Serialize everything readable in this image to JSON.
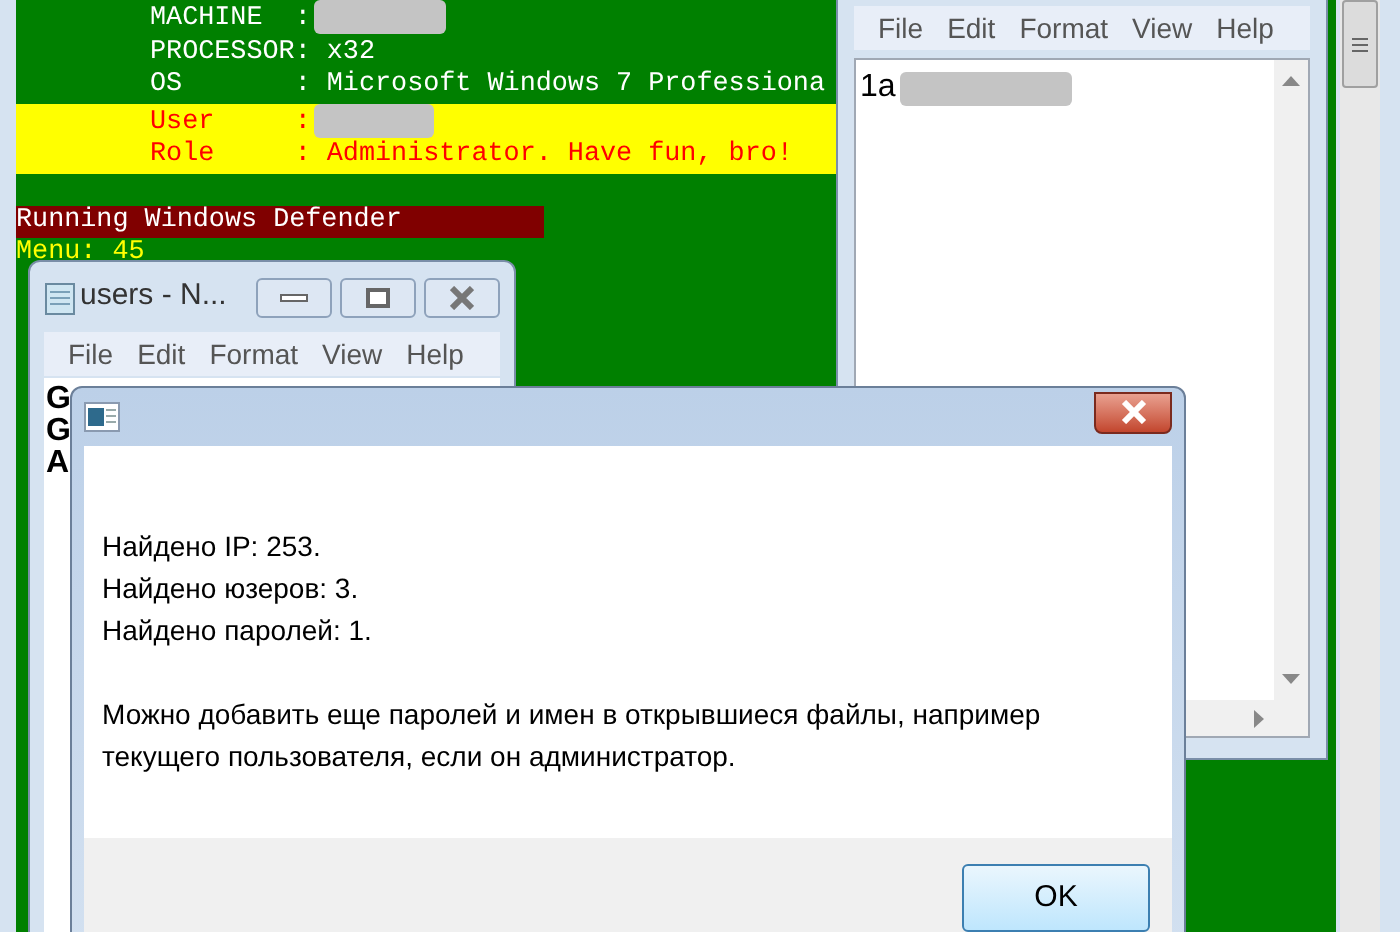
{
  "console": {
    "lines": [
      {
        "text": "MACHINE  :",
        "redacted": true,
        "highlight": false
      },
      {
        "text": "PROCESSOR: x32",
        "redacted": false,
        "highlight": false
      },
      {
        "text": "OS       : Microsoft Windows 7 Professiona",
        "redacted": false,
        "highlight": false
      },
      {
        "text": "User     :",
        "redacted": true,
        "highlight": true
      },
      {
        "text": "Role     : Administrator. Have fun, bro!",
        "redacted": false,
        "highlight": true
      }
    ],
    "status": "Running Windows Defender",
    "menu_line": "Menu: 45"
  },
  "notepad_right": {
    "menu": [
      "File",
      "Edit",
      "Format",
      "View",
      "Help"
    ],
    "text": "1a",
    "redacted": true
  },
  "notepad_users": {
    "title": "users - N...",
    "menu": [
      "File",
      "Edit",
      "Format",
      "View",
      "Help"
    ],
    "lines": [
      "G",
      "G",
      "A"
    ]
  },
  "dialog": {
    "lines": [
      "Найдено IP: 253.",
      "Найдено юзеров: 3.",
      "Найдено паролей: 1."
    ],
    "message": "Можно добавить еще паролей и имен в открывшиеся файлы, например текущего пользователя, если он администратор.",
    "button": "OK"
  }
}
